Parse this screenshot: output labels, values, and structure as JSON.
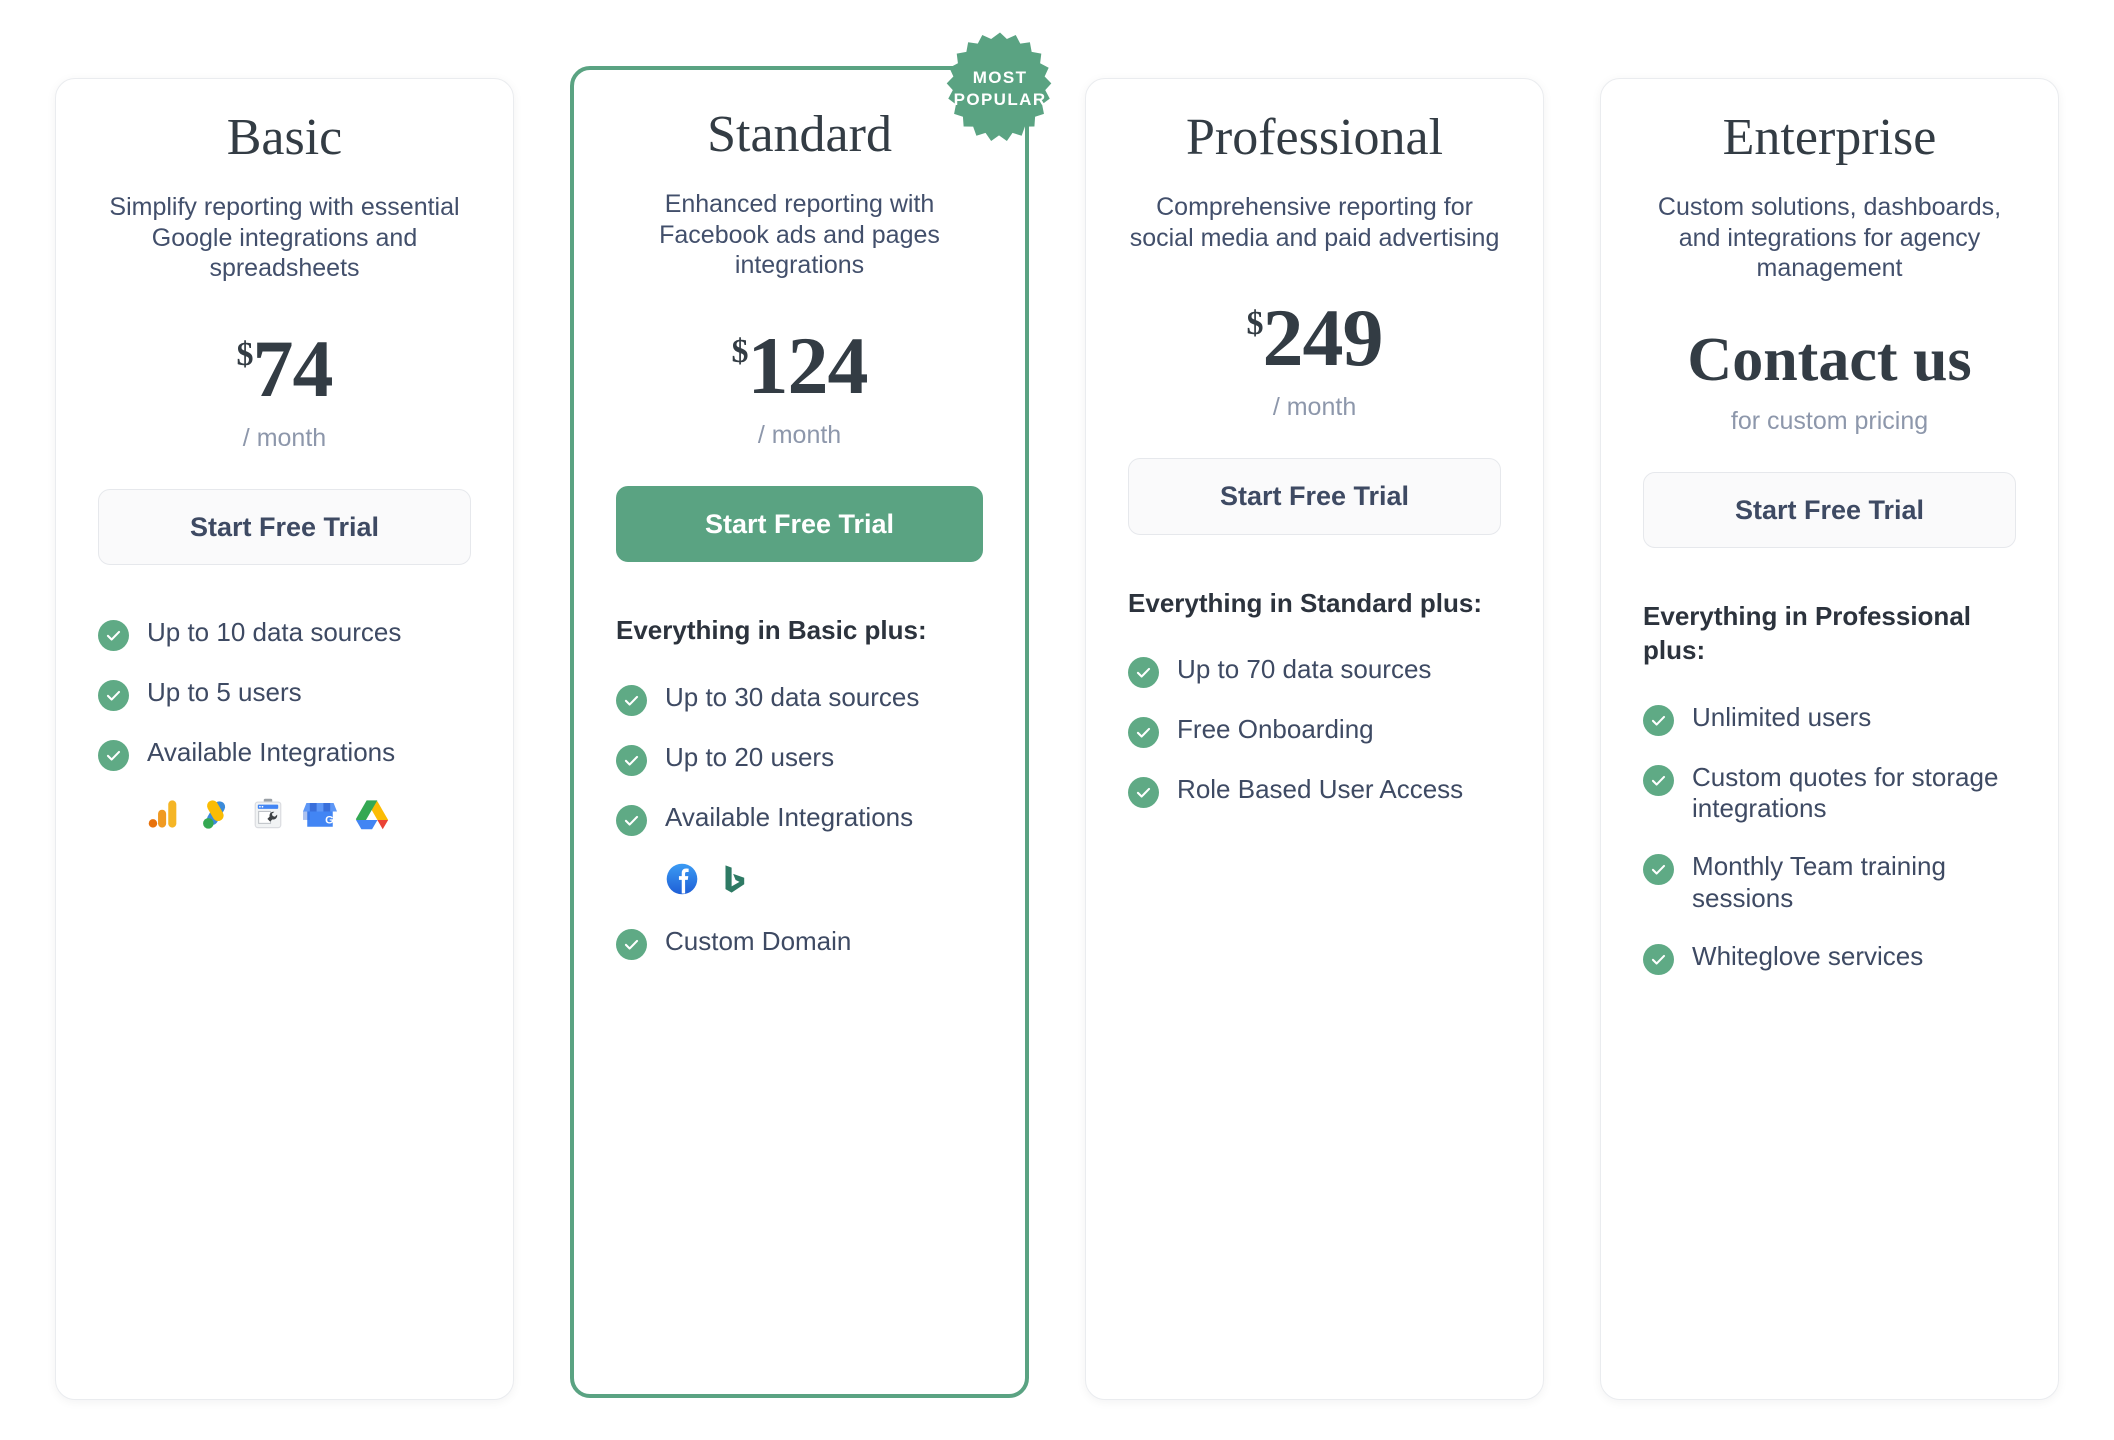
{
  "badge": {
    "label": "MOST POPULAR"
  },
  "plans": [
    {
      "name": "Basic",
      "description": "Simplify reporting with essential Google integrations and spreadsheets",
      "currency": "$",
      "price": "74",
      "period": "/ month",
      "cta_label": "Start Free Trial",
      "cta_style": "ghost",
      "features_title": "",
      "features": [
        "Up to 10 data sources",
        "Up to 5 users",
        "Available Integrations"
      ],
      "integrations": [
        "google-analytics-icon",
        "google-ads-icon",
        "google-search-console-icon",
        "google-my-business-icon",
        "google-drive-icon"
      ],
      "extra_features": []
    },
    {
      "name": "Standard",
      "description": "Enhanced reporting with Facebook ads and pages integrations",
      "currency": "$",
      "price": "124",
      "period": "/ month",
      "cta_label": "Start Free Trial",
      "cta_style": "solid",
      "features_title": "Everything in Basic plus:",
      "features": [
        "Up to 30 data sources",
        "Up to 20 users",
        "Available Integrations"
      ],
      "integrations": [
        "facebook-icon",
        "bing-icon"
      ],
      "extra_features": [
        "Custom Domain"
      ]
    },
    {
      "name": "Professional",
      "description": "Comprehensive reporting for social media and paid advertising",
      "currency": "$",
      "price": "249",
      "period": "/ month",
      "cta_label": "Start Free Trial",
      "cta_style": "ghost",
      "features_title": "Everything in Standard plus:",
      "features": [
        "Up to 70 data sources",
        "Free Onboarding",
        "Role Based User Access"
      ],
      "integrations": [],
      "extra_features": []
    },
    {
      "name": "Enterprise",
      "description": "Custom solutions, dashboards, and integrations for agency management",
      "currency": "",
      "price": "Contact us",
      "period": "for custom pricing",
      "cta_label": "Start Free Trial",
      "cta_style": "ghost",
      "features_title": "Everything in Professional plus:",
      "features": [
        "Unlimited users",
        "Custom quotes for storage integrations",
        "Monthly Team training sessions",
        "Whiteglove services"
      ],
      "integrations": [],
      "extra_features": []
    }
  ],
  "colors": {
    "accent_green": "#5aa382",
    "check_green": "#5faa85",
    "text_dark": "#333c44",
    "text_body": "#3e4a63",
    "muted": "#8d97ab"
  }
}
